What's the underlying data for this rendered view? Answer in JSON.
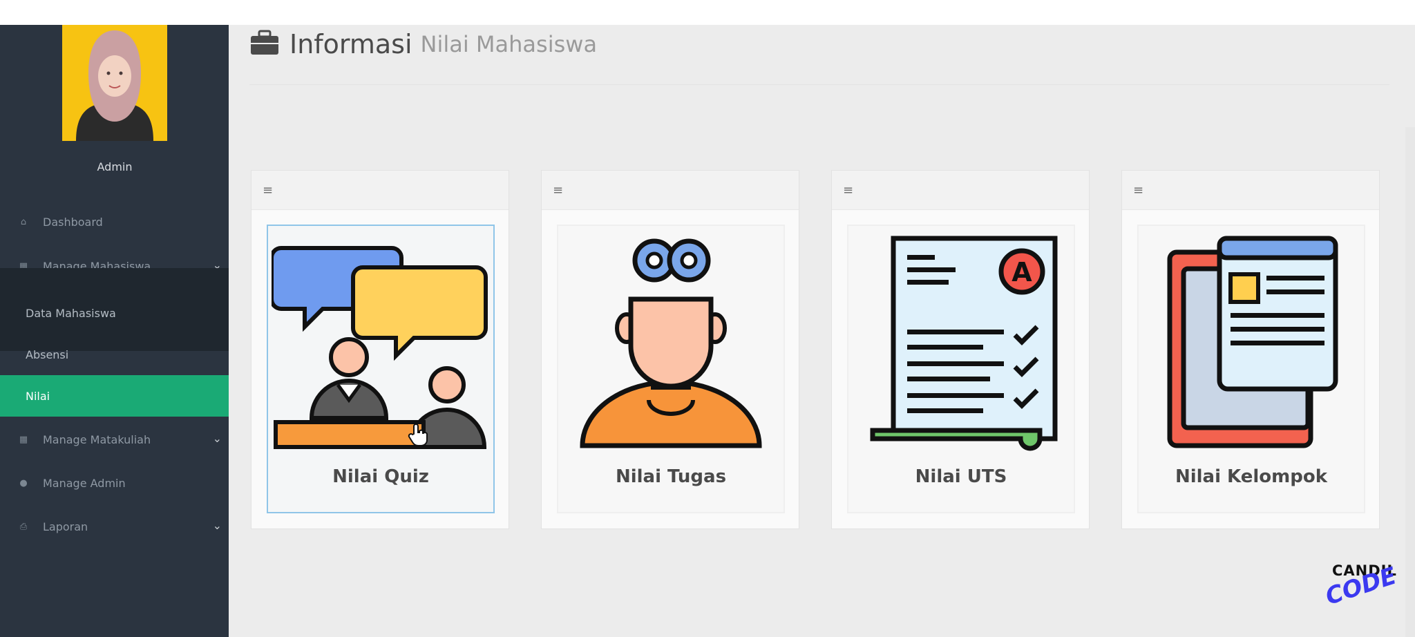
{
  "user": {
    "name": "Admin"
  },
  "sidebar": {
    "items": [
      {
        "label": "Dashboard",
        "icon": "home-icon"
      },
      {
        "label": "Manage Mahasiswa",
        "icon": "table-icon"
      },
      {
        "label": "Manage Matakuliah",
        "icon": "table-icon"
      },
      {
        "label": "Manage Admin",
        "icon": "user-icon"
      },
      {
        "label": "Laporan",
        "icon": "print-icon"
      }
    ],
    "submenu": [
      {
        "label": "Data Mahasiswa"
      },
      {
        "label": "Absensi"
      },
      {
        "label": "Nilai",
        "active": true
      }
    ]
  },
  "header": {
    "title": "Informasi",
    "subtitle": "Nilai Mahasiswa",
    "icon": "briefcase-icon"
  },
  "cards": [
    {
      "label": "Nilai Quiz",
      "icon": "discussion-icon"
    },
    {
      "label": "Nilai Tugas",
      "icon": "student-thinking-icon"
    },
    {
      "label": "Nilai UTS",
      "icon": "graded-exam-icon"
    },
    {
      "label": "Nilai Kelompok",
      "icon": "documents-icon"
    }
  ],
  "watermark": {
    "line1": "CANDIL",
    "line2": "CODE"
  },
  "colors": {
    "sidebar": "#2b3440",
    "active": "#1aaa75",
    "content_bg": "#ececec",
    "avatar_bg": "#f7c312"
  }
}
